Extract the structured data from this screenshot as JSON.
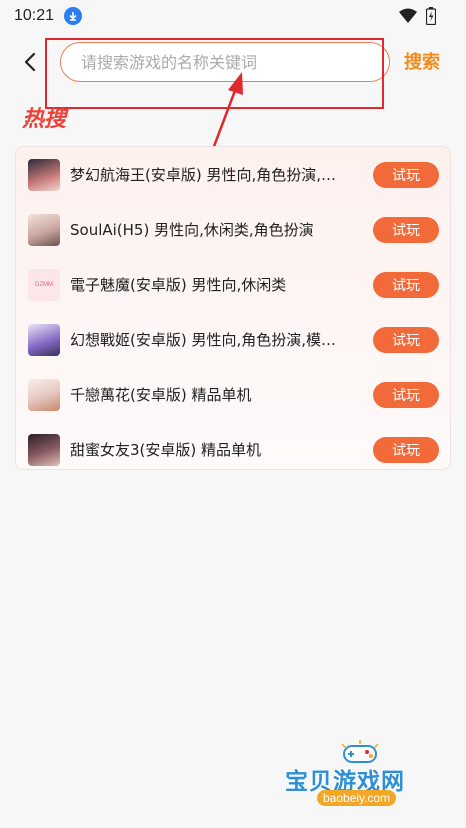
{
  "status_bar": {
    "time": "10:21",
    "icons": [
      "download-icon",
      "wifi-icon",
      "battery-icon"
    ]
  },
  "search": {
    "placeholder": "请搜索游戏的名称关键词",
    "value": "",
    "button_label": "搜索"
  },
  "hot": {
    "title": "热搜",
    "items": [
      {
        "name": "梦幻航海王(安卓版)",
        "tags": "男性向,角色扮演,…",
        "thumb_color": "#6d4a6f",
        "button": "试玩"
      },
      {
        "name": "SoulAi(H5)",
        "tags": "男性向,休闲类,角色扮演",
        "thumb_color": "#c9a7a0",
        "button": "试玩"
      },
      {
        "name": "電子魅魔(安卓版)",
        "tags": "男性向,休闲类",
        "thumb_color": "#f4a3b8",
        "thumb_text": "DZMM",
        "button": "试玩"
      },
      {
        "name": "幻想戰姬(安卓版)",
        "tags": "男性向,角色扮演,模…",
        "thumb_color": "#8a6cc8",
        "button": "试玩"
      },
      {
        "name": "千戀萬花(安卓版)",
        "tags": "精品单机",
        "thumb_color": "#e8c9c4",
        "button": "试玩"
      },
      {
        "name": "甜蜜女友3(安卓版)",
        "tags": "精品单机",
        "thumb_color": "#5a3e46",
        "button": "试玩"
      }
    ]
  },
  "watermark": {
    "title": "宝贝游戏网",
    "url": "baobeiy.com"
  },
  "colors": {
    "accent": "#f26a3a",
    "search_label": "#f28c1c",
    "hot_title": "#ee4238",
    "annotation": "#e0282f"
  }
}
